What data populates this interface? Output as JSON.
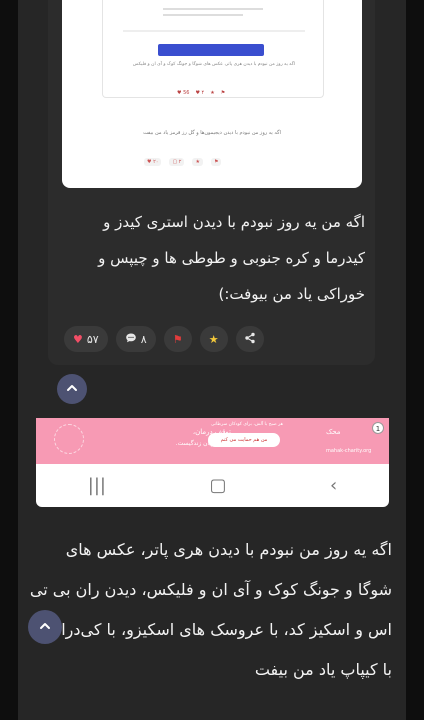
{
  "embedded_screenshot": {
    "top_caption": "",
    "banner_label": "",
    "quoted_text": "اگه یه روز من نبودم با دیدن هری پاتر، عکس های شوگا و جونگ کوک و آی ان و فلیکس",
    "bottom_text": "اگه یه روز من نبودم با دیدن دیجیمون‌ها و گل رز قرمز یاد من بیفت",
    "reacts_top": [
      "♥ 56",
      "♥ ۴",
      "★",
      "⚑"
    ],
    "reacts_bottom": [
      "♥ ۲۰",
      "▢ ۲",
      "★",
      "⚑"
    ]
  },
  "post": {
    "text": "اگه من یه روز نبودم با دیدن استری کیدز و کیدرما و کره جنوبی و طوطی ها و چیپس و خوراکی یاد من بیوفت:)",
    "actions": {
      "likes": "۵۷",
      "comments": "۸"
    }
  },
  "ad": {
    "title": "توقف درمان،",
    "subtitle": "قطع جریان زندگیست.",
    "top_line": "هر صبح با آلش، برای کودکان سرطانی",
    "button": "من هم حمایت می کنم",
    "brand": "محک",
    "url": "mahak-charity.org",
    "close": "1"
  },
  "main": {
    "text": "اگه یه روز من نبودم با دیدن هری پاتر، عکس های شوگا و جونگ کوک و آی ان و فلیکس، دیدن ران بی تی اس و اسکیز کد، با عروسک های اسکیزو، با کی‌دراما و با کیپاپ یاد من بیفت"
  },
  "icons": {
    "up": "chevron-up-icon",
    "share": "share-icon",
    "star": "star-icon",
    "flag": "flag-icon",
    "comment": "comment-icon",
    "heart": "heart-icon"
  },
  "colors": {
    "up_button": "#4d5272",
    "heart": "#f24e66",
    "ad_bg": "#f79ab4"
  }
}
